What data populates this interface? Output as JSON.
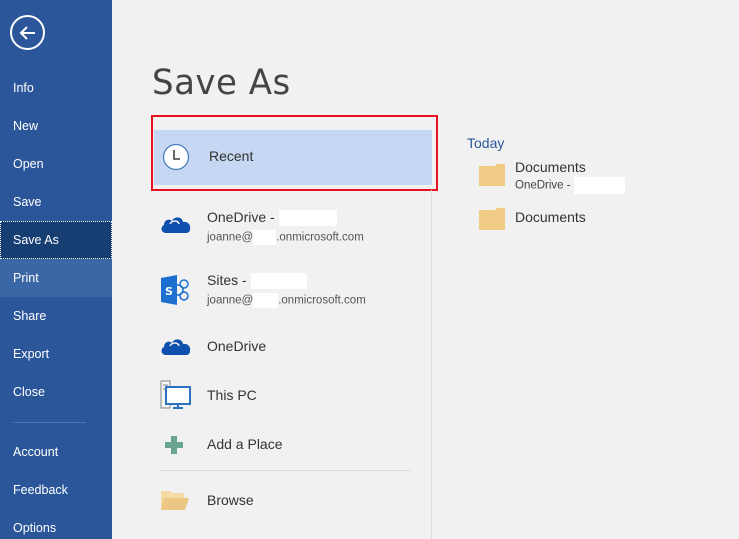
{
  "sidebar": {
    "back_label": "Back",
    "items": [
      {
        "label": "Info"
      },
      {
        "label": "New"
      },
      {
        "label": "Open"
      },
      {
        "label": "Save"
      },
      {
        "label": "Save As",
        "active": true
      },
      {
        "label": "Print"
      },
      {
        "label": "Share"
      },
      {
        "label": "Export"
      },
      {
        "label": "Close"
      },
      {
        "label": "Account"
      },
      {
        "label": "Feedback"
      },
      {
        "label": "Options"
      }
    ]
  },
  "main": {
    "title": "Save As",
    "places": {
      "recent": {
        "label": "Recent",
        "icon": "clock-icon",
        "selected": true
      },
      "onedrive_business": {
        "title": "OneDrive - ",
        "sub_prefix": "joanne@",
        "sub_suffix": ".onmicrosoft.com",
        "icon": "onedrive-cloud-icon"
      },
      "sites": {
        "title": "Sites - ",
        "sub_prefix": "joanne@",
        "sub_suffix": ".onmicrosoft.com",
        "icon": "sharepoint-icon"
      },
      "onedrive": {
        "title": "OneDrive",
        "icon": "onedrive-cloud-icon"
      },
      "this_pc": {
        "title": "This PC",
        "icon": "computer-icon"
      },
      "add_place": {
        "title": "Add a Place",
        "icon": "plus-icon"
      },
      "browse": {
        "title": "Browse",
        "icon": "open-folder-icon"
      }
    },
    "recent_pane": {
      "group_label": "Today",
      "folders": [
        {
          "name": "Documents",
          "location": "OneDrive - "
        },
        {
          "name": "Documents",
          "location": ""
        }
      ]
    }
  },
  "colors": {
    "sidebar_bg": "#2b579a",
    "sidebar_active": "#163e73",
    "selection": "#c5d7f2",
    "highlight_frame": "#e81123",
    "accent_text": "#2b579a",
    "folder": "#f0cb86"
  }
}
